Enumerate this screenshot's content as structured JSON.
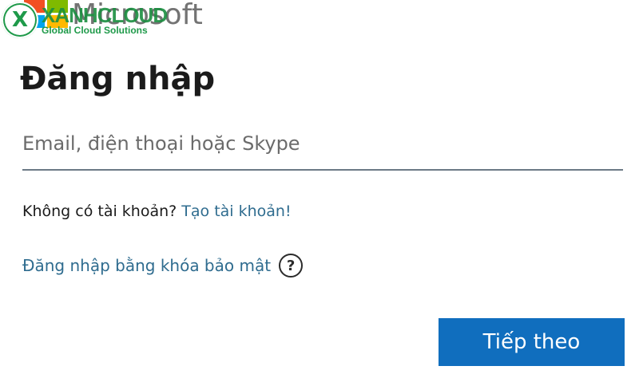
{
  "brand": {
    "name": "Microsoft",
    "watermark_brand": "XANHCLOUD",
    "watermark_tagline": "Global Cloud Solutions",
    "watermark_logo_letter": "X"
  },
  "signin": {
    "title": "Đăng nhập",
    "email_placeholder": "Email, điện thoại hoặc Skype",
    "email_value": "",
    "no_account_text": "Không có tài khoản?",
    "create_account_link": "Tạo tài khoản!",
    "security_key_link": "Đăng nhập bằng khóa bảo mật",
    "help_icon_glyph": "?",
    "next_button": "Tiếp theo"
  },
  "colors": {
    "accent": "#106ebe",
    "link": "#2f6c8f",
    "watermark_green": "#1f9a4a"
  }
}
